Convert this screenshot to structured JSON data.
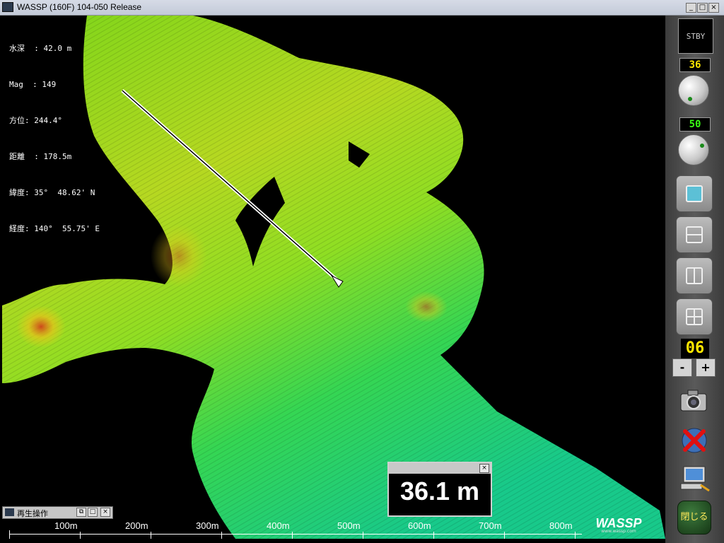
{
  "window": {
    "title": "WASSP (160F) 104-050  Release",
    "buttons": [
      "_",
      "□",
      "×"
    ]
  },
  "info": {
    "depth": "水深  : 42.0 m",
    "mag": "Mag  : 149",
    "bearing": "方位: 244.4°",
    "distance": "距離  : 178.5m",
    "latitude": "緯度: 35°  48.62' N",
    "longitude": "経度: 140°  55.75' E"
  },
  "panel": {
    "mode": "STBY",
    "gain_value": "36",
    "gain_color": "#ffe600",
    "range_value": "50",
    "range_color": "#39ff14",
    "zoom_value": "06",
    "minus": "-",
    "plus": "+",
    "close_label": "閉じる"
  },
  "playback": {
    "title": "再生操作",
    "buttons": [
      "⧉",
      "□",
      "×"
    ]
  },
  "depth_readout": {
    "value": "36.1 m",
    "close": "×"
  },
  "scale": {
    "labels": [
      "100m",
      "200m",
      "300m",
      "400m",
      "500m",
      "600m",
      "700m",
      "800m"
    ]
  },
  "logo": {
    "name": "WASSP",
    "url": "www.wassp.com"
  }
}
